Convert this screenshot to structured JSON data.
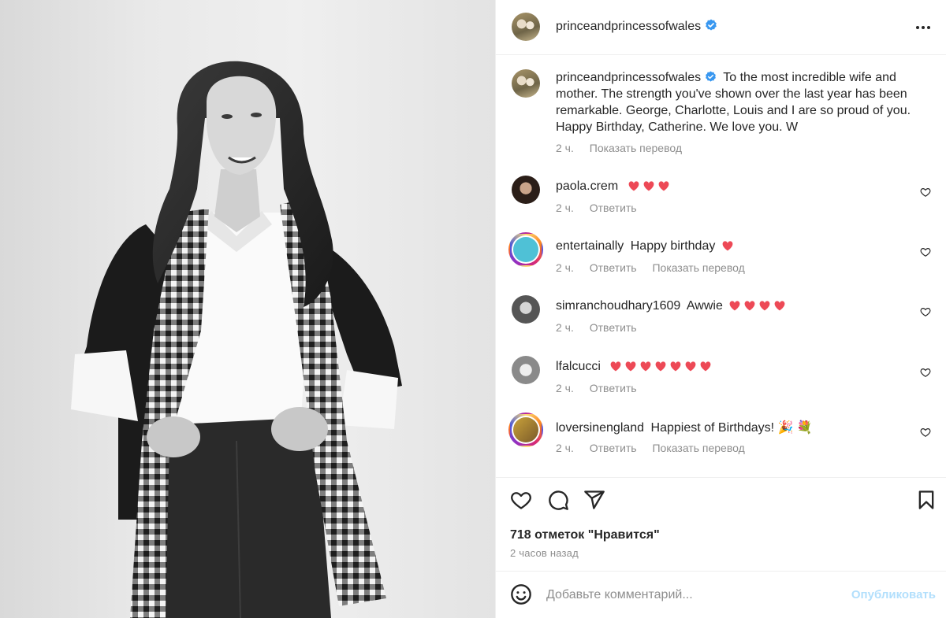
{
  "post": {
    "author": "princeandprincessofwales",
    "verified": true,
    "more_icon": "more-horizontal-icon"
  },
  "caption": {
    "username": "princeandprincessofwales",
    "text": "To the most incredible wife and mother. The strength you've shown over the last year has been remarkable. George, Charlotte, Louis and I are so proud of you. Happy Birthday, Catherine. We love you. W",
    "time": "2 ч.",
    "translate": "Показать перевод"
  },
  "comments": [
    {
      "username": "paola.crem",
      "text": "",
      "hearts": 3,
      "time": "2 ч.",
      "reply": "Ответить",
      "translate": ""
    },
    {
      "username": "entertainally",
      "text": "Happy birthday",
      "hearts": 1,
      "time": "2 ч.",
      "reply": "Ответить",
      "translate": "Показать перевод"
    },
    {
      "username": "simranchoudhary1609",
      "text": "Awwie",
      "hearts": 4,
      "time": "2 ч.",
      "reply": "Ответить",
      "translate": ""
    },
    {
      "username": "lfalcucci",
      "text": "",
      "hearts": 7,
      "time": "2 ч.",
      "reply": "Ответить",
      "translate": ""
    },
    {
      "username": "loversinengland",
      "text": "Happiest of Birthdays! 🎉 💐",
      "hearts": 0,
      "time": "2 ч.",
      "reply": "Ответить",
      "translate": "Показать перевод"
    }
  ],
  "actions": {
    "like_icon": "heart-outline-icon",
    "comment_icon": "comment-bubble-icon",
    "share_icon": "paper-plane-icon",
    "save_icon": "bookmark-icon"
  },
  "likes": "718 отметок \"Нравится\"",
  "posted_ago": "2 часов назад",
  "add_comment": {
    "placeholder": "Добавьте комментарий...",
    "post_label": "Опубликовать",
    "emoji_icon": "smiley-icon"
  },
  "colors": {
    "heart_red": "#ed4956",
    "verified_blue": "#3897f0",
    "muted": "#8e8e8e",
    "post_button_disabled": "#b2dffc"
  }
}
